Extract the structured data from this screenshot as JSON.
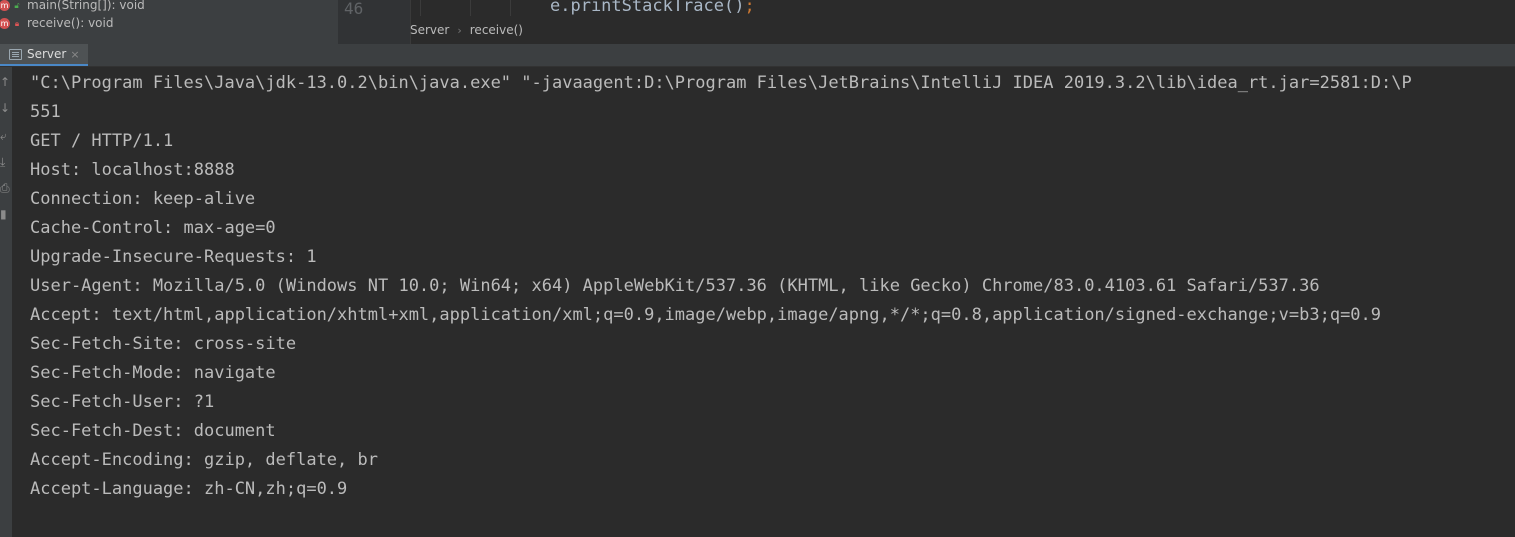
{
  "structure": {
    "items": [
      {
        "badge": "m",
        "visibility": "public",
        "label": "main(String[]): void"
      },
      {
        "badge": "m",
        "visibility": "private",
        "label": "receive(): void"
      }
    ]
  },
  "editor": {
    "line_number": "46",
    "code_text": "e.printStackTrace()",
    "code_semicolon": ";"
  },
  "breadcrumb": {
    "items": [
      "Server",
      "receive()"
    ],
    "separator": "›"
  },
  "run_window": {
    "tab_label": "Server",
    "tab_close": "×"
  },
  "side_toolbar": {
    "icons": [
      "scroll-up-icon",
      "scroll-down-icon",
      "soft-wrap-icon",
      "scroll-to-end-icon",
      "print-icon",
      "clear-icon"
    ]
  },
  "console": {
    "lines": [
      "\"C:\\Program Files\\Java\\jdk-13.0.2\\bin\\java.exe\" \"-javaagent:D:\\Program Files\\JetBrains\\IntelliJ IDEA 2019.3.2\\lib\\idea_rt.jar=2581:D:\\P",
      "551",
      "GET / HTTP/1.1",
      "Host: localhost:8888",
      "Connection: keep-alive",
      "Cache-Control: max-age=0",
      "Upgrade-Insecure-Requests: 1",
      "User-Agent: Mozilla/5.0 (Windows NT 10.0; Win64; x64) AppleWebKit/537.36 (KHTML, like Gecko) Chrome/83.0.4103.61 Safari/537.36",
      "Accept: text/html,application/xhtml+xml,application/xml;q=0.9,image/webp,image/apng,*/*;q=0.8,application/signed-exchange;v=b3;q=0.9",
      "Sec-Fetch-Site: cross-site",
      "Sec-Fetch-Mode: navigate",
      "Sec-Fetch-User: ?1",
      "Sec-Fetch-Dest: document",
      "Accept-Encoding: gzip, deflate, br",
      "Accept-Language: zh-CN,zh;q=0.9"
    ]
  },
  "colors": {
    "background": "#2b2b2b",
    "panel": "#3c3f41",
    "console_text": "#bbbbbb",
    "method_badge": "#d25252",
    "tab_underline": "#4a88c7"
  }
}
